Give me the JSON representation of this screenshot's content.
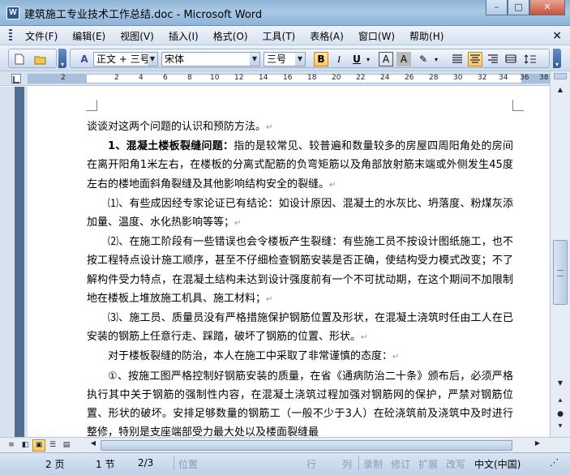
{
  "window": {
    "app_icon": "W",
    "title": "建筑施工专业技术工作总结.doc - Microsoft Word",
    "min": "–",
    "max": "□",
    "close": "✕"
  },
  "menubar": {
    "items": [
      "文件(F)",
      "编辑(E)",
      "视图(V)",
      "插入(I)",
      "格式(O)",
      "工具(T)",
      "表格(A)",
      "窗口(W)",
      "帮助(H)"
    ],
    "doc_close": "×"
  },
  "toolbar": {
    "new_icon": "new-document-icon",
    "open_icon": "open-folder-icon",
    "style_value": "正文 + 三号",
    "font_value": "宋体",
    "size_value": "三号",
    "bold": "B",
    "italic": "I",
    "underline": "U",
    "char_border": "A",
    "char_shading": "A",
    "highlight": "✎",
    "active_color": "#ffc75c"
  },
  "ruler": {
    "numbers": [
      "2",
      "2",
      "4",
      "6",
      "8",
      "10",
      "12",
      "14",
      "16",
      "18",
      "20",
      "22",
      "24",
      "26",
      "28",
      "30",
      "32",
      "34",
      "36",
      "38"
    ]
  },
  "document": {
    "pilcrow": "↵",
    "paragraphs": [
      {
        "indent": false,
        "bold_lead": "",
        "text": "谈谈对这两个问题的认识和预防方法。"
      },
      {
        "indent": true,
        "bold_lead": "1、混凝土楼板裂缝问题：",
        "text": "指的是较常见、较普遍和数量较多的房屋四周阳角处的房间在离开阳角1米左右，在楼板的分离式配筋的负弯矩筋以及角部放射筋末端或外侧发生45度左右的楼地面斜角裂缝及其他影响结构安全的裂缝。"
      },
      {
        "indent": true,
        "bold_lead": "",
        "text": "⑴、有些成因经专家论证已有结论：如设计原因、混凝土的水灰比、坍落度、粉煤灰添加量、温度、水化热影响等等；"
      },
      {
        "indent": true,
        "bold_lead": "",
        "text": "⑵、在施工阶段有一些错误也会令楼板产生裂缝：有些施工员不按设计图纸施工，也不按工程特点设计施工顺序，甚至不仔细检查钢筋安装是否正确，使结构受力模式改变；不了解构件受力特点，在混凝土结构未达到设计强度前有一个不可扰动期，在这个期间不加限制地在楼板上堆放施工机具、施工材料；"
      },
      {
        "indent": true,
        "bold_lead": "",
        "text": "⑶、施工员、质量员没有严格措施保护钢筋位置及形状，在混凝土浇筑时任由工人在已安装的钢筋上任意行走、踩踏，破坏了钢筋的位置、形状。"
      },
      {
        "indent": true,
        "bold_lead": "",
        "text": "对于楼板裂缝的防治，本人在施工中采取了非常谨慎的态度："
      },
      {
        "indent": true,
        "bold_lead": "",
        "text": "①、按施工图严格控制好钢筋安装的质量，在省《通病防治二十条》颁布后，必须严格执行其中关于钢筋的强制性内容，在混凝土浇筑过程加强对钢筋网的保护，严禁对钢筋位置、形状的破坏。安排足够数量的钢筋工（一般不少于3人）在砼浇筑前及浇筑中及时进行整修，特别是支座端部受力最大处以及楼面裂缝最"
      }
    ]
  },
  "status": {
    "page": "2 页",
    "section": "1 节",
    "pages": "2/3",
    "position": "位置",
    "row": "行",
    "col": "列",
    "rec": "录制",
    "trk": "修订",
    "ext": "扩展",
    "ovr": "改写",
    "lang": "中文(中国)"
  }
}
